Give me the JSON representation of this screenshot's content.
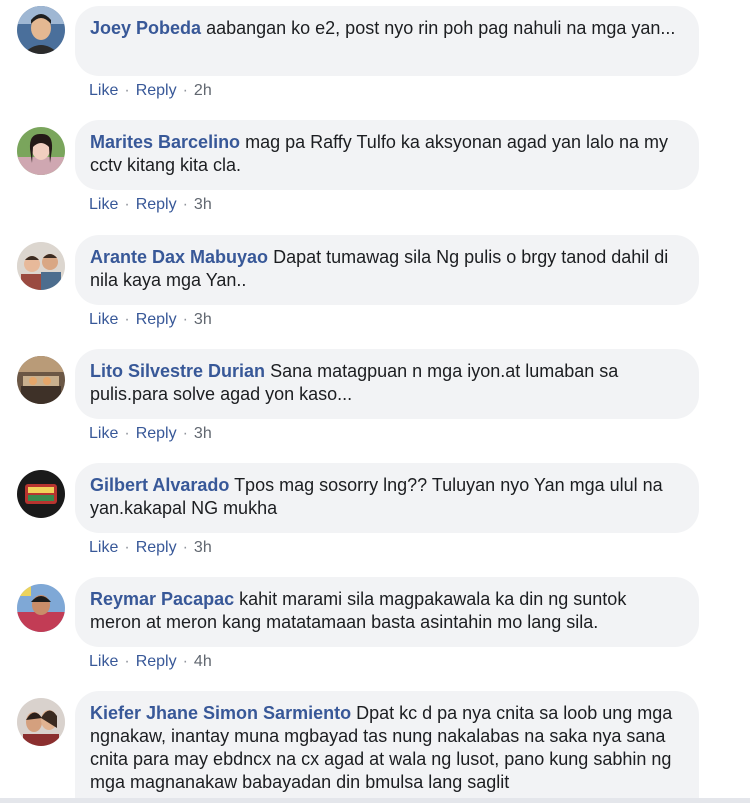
{
  "comments": [
    {
      "author": "Joey Pobeda",
      "text": "aabangan ko e2, post nyo rin poh pag nahuli na mga yan...",
      "like": "Like",
      "reply": "Reply",
      "time": "2h",
      "avatar_icon": "profile-photo"
    },
    {
      "author": "Marites Barcelino",
      "text": "mag pa Raffy Tulfo ka aksyonan agad yan lalo na my cctv kitang kita cla.",
      "like": "Like",
      "reply": "Reply",
      "time": "3h",
      "avatar_icon": "profile-photo"
    },
    {
      "author": "Arante Dax Mabuyao",
      "text": "Dapat tumawag sila Ng pulis o brgy tanod dahil di nila kaya mga Yan..",
      "like": "Like",
      "reply": "Reply",
      "time": "3h",
      "avatar_icon": "profile-photo"
    },
    {
      "author": "Lito Silvestre Durian",
      "text": "Sana matagpuan n mga iyon.at lumaban sa pulis.para solve agad yon kaso...",
      "like": "Like",
      "reply": "Reply",
      "time": "3h",
      "avatar_icon": "profile-photo"
    },
    {
      "author": "Gilbert Alvarado",
      "text": "Tpos mag sosorry lng?? Tuluyan nyo Yan mga ulul na yan.kakapal NG mukha",
      "like": "Like",
      "reply": "Reply",
      "time": "3h",
      "avatar_icon": "profile-photo"
    },
    {
      "author": "Reymar Pacapac",
      "text": "kahit marami sila magpakawala ka din ng suntok meron at meron kang matatamaan basta asintahin mo lang sila.",
      "like": "Like",
      "reply": "Reply",
      "time": "4h",
      "avatar_icon": "profile-photo"
    },
    {
      "author": "Kiefer Jhane Simon Sarmiento",
      "text": "Dpat kc d pa nya cnita sa loob ung mga ngnakaw, inantay muna mgbayad tas nung nakalabas na saka nya sana cnita para may ebdncx na cx agad at wala ng lusot, pano kung sabhin ng mga magnanakaw babayadan din bmulsa lang saglit",
      "avatar_icon": "profile-photo"
    }
  ],
  "colors": {
    "author": "#385898",
    "bubble": "#f2f3f5",
    "meta": "#616770"
  }
}
